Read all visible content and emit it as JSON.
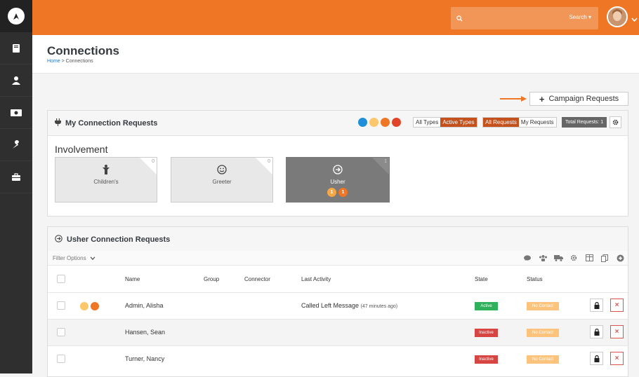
{
  "topbar": {
    "search_label": "Search ▾"
  },
  "header": {
    "title": "Connections",
    "breadcrumb_home": "Home",
    "breadcrumb_sep": " > ",
    "breadcrumb_current": "Connections"
  },
  "campaign_button": {
    "label": "Campaign Requests"
  },
  "my_requests": {
    "title": "My Connection Requests",
    "type_filter": [
      "All Types",
      "Active Types"
    ],
    "request_filter": [
      "All Requests",
      "My Requests"
    ],
    "total_label": "Total Requests: 1",
    "section_title": "Involvement",
    "tiles": [
      {
        "name": "Children's",
        "count": "0"
      },
      {
        "name": "Greeter",
        "count": "0"
      },
      {
        "name": "Usher",
        "count": "1",
        "badges": [
          "1",
          "1"
        ]
      }
    ]
  },
  "usher": {
    "title": "Usher Connection Requests",
    "filter_label": "Filter Options",
    "columns": [
      "Name",
      "Group",
      "Connector",
      "Last Activity",
      "State",
      "Status"
    ],
    "rows": [
      {
        "name": "Admin, Alisha",
        "activity": "Called Left Message",
        "activity_time": "(47 minutes ago)",
        "state": "Active",
        "status": "No Contact"
      },
      {
        "name": "Hansen, Sean",
        "activity": "",
        "activity_time": "",
        "state": "Inactive",
        "status": "No Contact"
      },
      {
        "name": "Turner, Nancy",
        "activity": "",
        "activity_time": "",
        "state": "Inactive",
        "status": "No Contact"
      }
    ]
  },
  "colors": {
    "accent": "#ee7625",
    "sidebar": "#2f2f2f",
    "active_toggle": "#c4501b",
    "state_active": "#2fb05a",
    "state_inactive": "#d64541",
    "status_no_contact": "#fbc37b",
    "dot_blue": "#1e8fd8",
    "dot_yellow": "#fcc66b",
    "dot_orange": "#ee7625",
    "dot_red": "#e0452a"
  }
}
